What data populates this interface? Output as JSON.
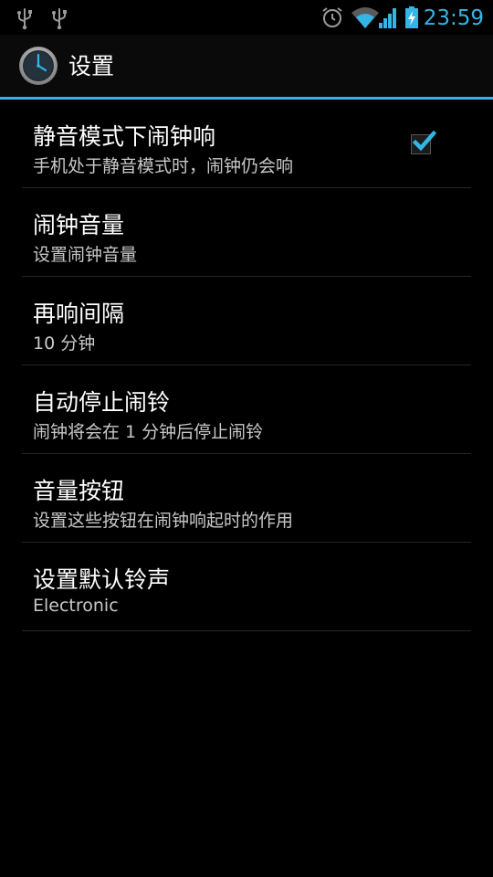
{
  "status_bar": {
    "time": "23:59",
    "left_icons": [
      "usb-icon",
      "usb-icon"
    ],
    "right_icons": [
      "alarm-icon",
      "wifi-icon",
      "signal-icon",
      "battery-charging-icon"
    ],
    "accent_color": "#33b5e5"
  },
  "action_bar": {
    "icon": "clock-icon",
    "title": "设置"
  },
  "preferences": [
    {
      "title": "静音模式下闹钟响",
      "summary": "手机处于静音模式时，闹钟仍会响",
      "checkbox": true,
      "checked": true
    },
    {
      "title": "闹钟音量",
      "summary": "设置闹钟音量"
    },
    {
      "title": "再响间隔",
      "summary": "10 分钟"
    },
    {
      "title": "自动停止闹铃",
      "summary": "闹钟将会在 1 分钟后停止闹铃"
    },
    {
      "title": "音量按钮",
      "summary": "设置这些按钮在闹钟响起时的作用"
    },
    {
      "title": "设置默认铃声",
      "summary": "Electronic"
    }
  ]
}
